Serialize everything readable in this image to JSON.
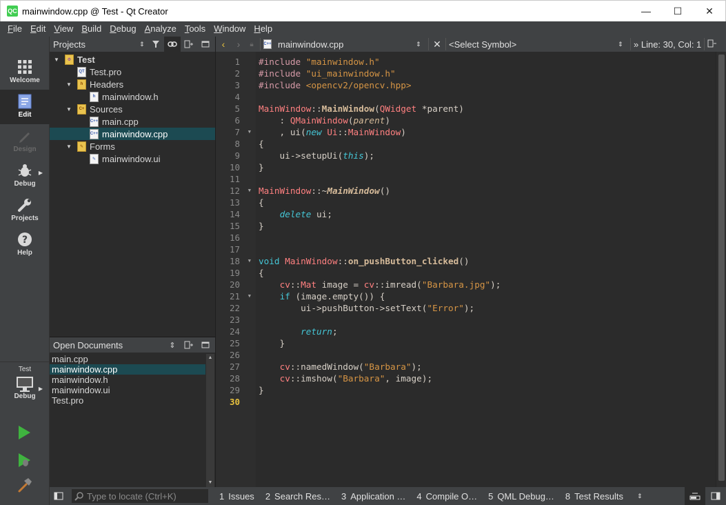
{
  "window": {
    "app_icon": "QC",
    "title": "mainwindow.cpp @ Test - Qt Creator",
    "minimize": "—",
    "maximize": "☐",
    "close": "✕"
  },
  "menu": [
    {
      "key": "F",
      "rest": "ile"
    },
    {
      "key": "E",
      "rest": "dit"
    },
    {
      "key": "V",
      "rest": "iew"
    },
    {
      "key": "B",
      "rest": "uild"
    },
    {
      "key": "D",
      "rest": "ebug"
    },
    {
      "key": "A",
      "rest": "nalyze"
    },
    {
      "key": "T",
      "rest": "ools"
    },
    {
      "key": "W",
      "rest": "indow"
    },
    {
      "key": "H",
      "rest": "elp"
    }
  ],
  "modes": {
    "welcome": "Welcome",
    "edit": "Edit",
    "design": "Design",
    "debug": "Debug",
    "projects": "Projects",
    "help": "Help",
    "kit_project": "Test",
    "kit_config": "Debug"
  },
  "projects_pane": {
    "title": "Projects",
    "items": [
      {
        "label": "Test",
        "icon": "qt-project-icon",
        "level": 0,
        "toggle": "▼"
      },
      {
        "label": "Test.pro",
        "icon": "pro-file-icon",
        "level": 1,
        "toggle": ""
      },
      {
        "label": "Headers",
        "icon": "folder-icon",
        "level": 1,
        "toggle": "▼"
      },
      {
        "label": "mainwindow.h",
        "icon": "header-file-icon",
        "level": 2,
        "toggle": ""
      },
      {
        "label": "Sources",
        "icon": "folder-icon",
        "level": 1,
        "toggle": "▼"
      },
      {
        "label": "main.cpp",
        "icon": "cpp-file-icon",
        "level": 2,
        "toggle": ""
      },
      {
        "label": "mainwindow.cpp",
        "icon": "cpp-file-icon",
        "level": 2,
        "toggle": "",
        "selected": true
      },
      {
        "label": "Forms",
        "icon": "folder-icon",
        "level": 1,
        "toggle": "▼"
      },
      {
        "label": "mainwindow.ui",
        "icon": "ui-file-icon",
        "level": 2,
        "toggle": ""
      }
    ]
  },
  "open_documents": {
    "title": "Open Documents",
    "items": [
      {
        "label": "main.cpp"
      },
      {
        "label": "mainwindow.cpp",
        "selected": true
      },
      {
        "label": "mainwindow.h"
      },
      {
        "label": "mainwindow.ui"
      },
      {
        "label": "Test.pro"
      }
    ]
  },
  "editor_toolbar": {
    "file": "mainwindow.cpp",
    "symbol": "<Select Symbol>",
    "position": "» Line: 30, Col: 1"
  },
  "editor": {
    "current_line": 30,
    "fold_lines": [
      7,
      12,
      18,
      21
    ],
    "lines": [
      [
        [
          "pp",
          "#include "
        ],
        [
          "str",
          "\"mainwindow.h\""
        ]
      ],
      [
        [
          "pp",
          "#include "
        ],
        [
          "str",
          "\"ui_mainwindow.h\""
        ]
      ],
      [
        [
          "pp",
          "#include "
        ],
        [
          "str",
          "<opencv2/opencv.hpp>"
        ]
      ],
      [],
      [
        [
          "cls",
          "MainWindow"
        ],
        [
          "op",
          "::"
        ],
        [
          "fn",
          "MainWindow"
        ],
        [
          "op",
          "("
        ],
        [
          "cls",
          "QWidget"
        ],
        [
          "op",
          " *parent)"
        ]
      ],
      [
        [
          "op",
          "    : "
        ],
        [
          "cls",
          "QMainWindow"
        ],
        [
          "op",
          "("
        ],
        [
          "par",
          "parent"
        ],
        [
          "op",
          ")"
        ]
      ],
      [
        [
          "op",
          "    , ui("
        ],
        [
          "kw",
          "new"
        ],
        [
          "op",
          " "
        ],
        [
          "cls",
          "Ui"
        ],
        [
          "op",
          "::"
        ],
        [
          "cls",
          "MainWindow"
        ],
        [
          "op",
          ")"
        ]
      ],
      [
        [
          "op",
          "{"
        ]
      ],
      [
        [
          "op",
          "    ui->setupUi("
        ],
        [
          "kw",
          "this"
        ],
        [
          "op",
          ");"
        ]
      ],
      [
        [
          "op",
          "}"
        ]
      ],
      [],
      [
        [
          "cls",
          "MainWindow"
        ],
        [
          "op",
          "::~"
        ],
        [
          "fni",
          "MainWindow"
        ],
        [
          "op",
          "()"
        ]
      ],
      [
        [
          "op",
          "{"
        ]
      ],
      [
        [
          "op",
          "    "
        ],
        [
          "kw",
          "delete"
        ],
        [
          "op",
          " ui;"
        ]
      ],
      [
        [
          "op",
          "}"
        ]
      ],
      [],
      [],
      [
        [
          "kwp",
          "void"
        ],
        [
          "op",
          " "
        ],
        [
          "cls",
          "MainWindow"
        ],
        [
          "op",
          "::"
        ],
        [
          "fn",
          "on_pushButton_clicked"
        ],
        [
          "op",
          "()"
        ]
      ],
      [
        [
          "op",
          "{"
        ]
      ],
      [
        [
          "op",
          "    "
        ],
        [
          "cls",
          "cv"
        ],
        [
          "op",
          "::"
        ],
        [
          "cls",
          "Mat"
        ],
        [
          "op",
          " image = "
        ],
        [
          "cls",
          "cv"
        ],
        [
          "op",
          "::imread("
        ],
        [
          "str",
          "\"Barbara.jpg\""
        ],
        [
          "op",
          ");"
        ]
      ],
      [
        [
          "op",
          "    "
        ],
        [
          "kwp",
          "if"
        ],
        [
          "op",
          " (image.empty()) {"
        ]
      ],
      [
        [
          "op",
          "        ui->pushButton->setText("
        ],
        [
          "str",
          "\"Error\""
        ],
        [
          "op",
          ");"
        ]
      ],
      [],
      [
        [
          "op",
          "        "
        ],
        [
          "kw",
          "return"
        ],
        [
          "op",
          ";"
        ]
      ],
      [
        [
          "op",
          "    }"
        ]
      ],
      [],
      [
        [
          "op",
          "    "
        ],
        [
          "cls",
          "cv"
        ],
        [
          "op",
          "::namedWindow("
        ],
        [
          "str",
          "\"Barbara\""
        ],
        [
          "op",
          ");"
        ]
      ],
      [
        [
          "op",
          "    "
        ],
        [
          "cls",
          "cv"
        ],
        [
          "op",
          "::imshow("
        ],
        [
          "str",
          "\"Barbara\""
        ],
        [
          "op",
          ", image);"
        ]
      ],
      [
        [
          "op",
          "}"
        ]
      ],
      []
    ]
  },
  "bottom_bar": {
    "locate_placeholder": "Type to locate (Ctrl+K)",
    "tabs": [
      {
        "num": "1",
        "label": "Issues"
      },
      {
        "num": "2",
        "label": "Search Res…"
      },
      {
        "num": "3",
        "label": "Application …"
      },
      {
        "num": "4",
        "label": "Compile O…"
      },
      {
        "num": "5",
        "label": "QML Debug…"
      },
      {
        "num": "8",
        "label": "Test Results"
      }
    ]
  },
  "colors": {
    "accent_selection": "#1c4a52",
    "run_green": "#3fb33f",
    "current_line_number": "#e7c13e"
  }
}
